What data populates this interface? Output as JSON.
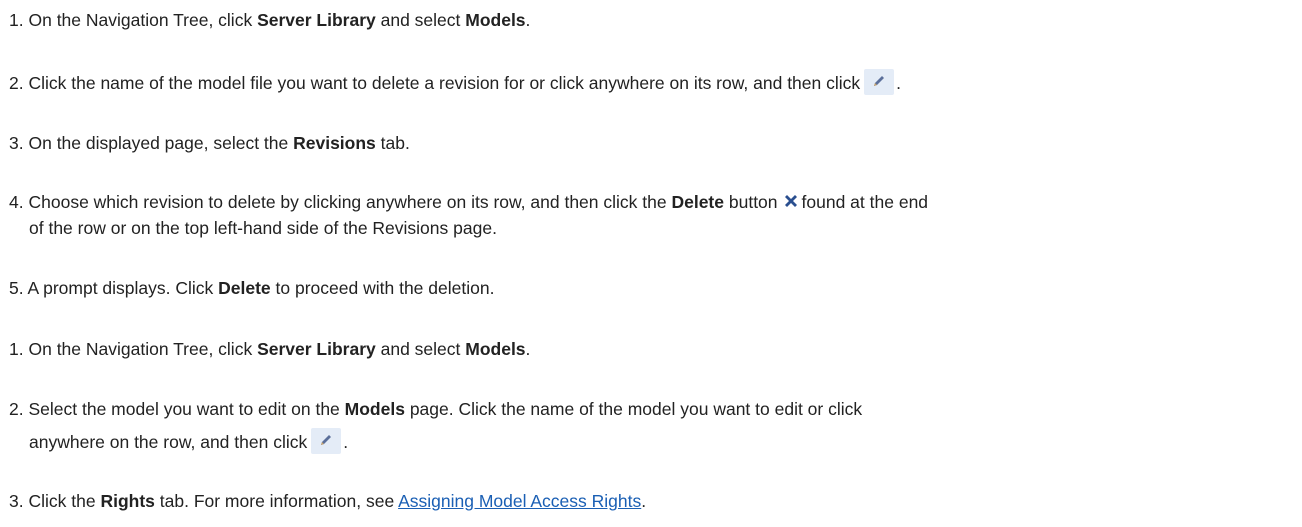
{
  "block1": {
    "step1": {
      "num": "1.",
      "t1": "On the Navigation Tree, click ",
      "b1": "Server Library",
      "t2": " and select ",
      "b2": "Models",
      "t3": "."
    },
    "step2": {
      "num": "2.",
      "t1": "Click the name of the model file you want to delete a revision for or click anywhere on its row, and then click",
      "t2": "."
    },
    "step3": {
      "num": "3.",
      "t1": "On the displayed page, select the ",
      "b1": "Revisions",
      "t2": " tab."
    },
    "step4": {
      "num": "4.",
      "t1": "Choose which revision to delete by clicking anywhere on its row, and then click the ",
      "b1": "Delete",
      "t2": " button",
      "t3": "found at the end",
      "line2": "of the row or on the top left-hand side of the Revisions page."
    },
    "step5": {
      "num": "5.",
      "t1": "A prompt displays. Click ",
      "b1": "Delete",
      "t2": " to proceed with the deletion."
    }
  },
  "block2": {
    "step1": {
      "num": "1.",
      "t1": "On the Navigation Tree, click ",
      "b1": "Server Library",
      "t2": " and select ",
      "b2": "Models",
      "t3": "."
    },
    "step2": {
      "num": "2.",
      "t1": "Select the model you want to edit on the ",
      "b1": "Models",
      "t2": " page. Click the name of the model you want to edit or click",
      "line2": "anywhere on the row, and then click",
      "t3": "."
    },
    "step3": {
      "num": "3.",
      "t1": "Click the ",
      "b1": "Rights",
      "t2": " tab. For more information, see ",
      "link": "Assigning Model Access Rights",
      "t3": "."
    }
  },
  "icons": {
    "edit": "pencil-icon",
    "delete": "x-delete-icon"
  },
  "colors": {
    "text": "#222222",
    "link": "#1a5fb4",
    "icon_bg": "#e4ecf7",
    "delete_icon": "#2a4f8f"
  }
}
